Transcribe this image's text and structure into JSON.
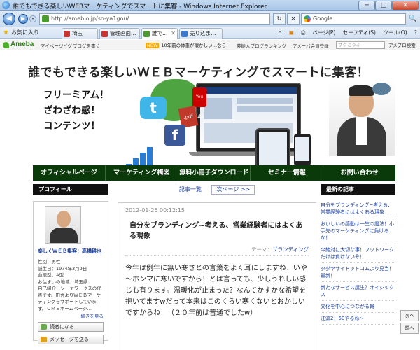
{
  "window": {
    "title": "誰でもできる楽しいWEBマーケティングでスマートに集客 - Windows Internet Explorer",
    "minimize": "─",
    "maximize": "□",
    "close": "✕"
  },
  "address": {
    "url": "http://ameblo.jp/so-ya1gou/",
    "refresh": "↻",
    "stop": "✕",
    "search_engine": "Google",
    "search_go": "🔍"
  },
  "toolbar": {
    "favorites": "お気に入り",
    "tabs": [
      {
        "label": "埼玉",
        "color": "#c33"
      },
      {
        "label": "管理画面…",
        "color": "#c33"
      },
      {
        "label": "誰で…",
        "color": "#4a9c2e"
      },
      {
        "label": "売り込ま…",
        "color": "#3a7ad0"
      }
    ],
    "commands": [
      "ページ(P)",
      "セーフティ(S)",
      "ツール(O)",
      "?"
    ]
  },
  "ameba_bar": {
    "logo": "Ameba",
    "links": [
      "マイページ",
      "ピグ",
      "ブログを書く"
    ],
    "news_badge": "NEW",
    "news": "10年前の体重が懐かしい…なら",
    "links2": [
      "芸能人ブログランキング",
      "アメーバ会員登録"
    ],
    "search_placeholder": "ザクとうふ",
    "search_button": "アメブロ検索"
  },
  "header": {
    "title": "誰でもできる楽しいＷＥＢマーケティングでスマートに集客！",
    "slogan": [
      "フリーミアム！",
      "ざわざわ感！",
      "コンテンツ！"
    ],
    "icons": {
      "twitter": "t",
      "facebook": "f",
      "youtube": "You Tube",
      "pdf": ".pdf",
      "speech": "…"
    }
  },
  "nav": [
    "オフィシャルページ",
    "マーケティング構図",
    "無料小冊子ダウンロード",
    "セミナー情報",
    "お問い合わせ"
  ],
  "profile": {
    "heading": "プロフィール",
    "name": "楽しくＷＥＢ集客：高橋耕也",
    "lines": [
      "性別：男性",
      "誕生日：1974年3月9日",
      "血液型：A型",
      "お住まいの地域：埼玉県",
      "自己紹介：ソーヤワークスの代表です。田舎よりＷＥＢマーケティングをサポートしています。ＣＭＳホームページ…"
    ],
    "more": "続きを見る",
    "reader_button": "読者になる",
    "message_button": "メッセージを送る"
  },
  "article": {
    "list_link": "記事一覧",
    "next_link": "次ページ >>",
    "date": "2012-01-26 00:12:15",
    "title": "自分をブランディング~考える、営業経験者にはよくある現象",
    "theme_label": "テーマ：",
    "theme": "ブランディング",
    "body": "今年は例年に無い寒さとの言葉をよく耳にしますね、いや～ホンマに寒いですから！とは言っても、少しうれしい感じも有ります。温暖化が止まった？なんてかすかな希望を抱いてますwだって本来はこのくらい寒くないとおかしいですからね！（２０年前は普通でしたw）"
  },
  "recent": {
    "heading": "最新の記事",
    "items": [
      "自分をブランディング~考える、営業経験者にはよくある現象",
      "おいしいの感動は一生の魔法！小手先のマーケティングに負けるな！",
      "今絶対に大切な事！フットワークだけは負けないぞ！",
      "タダヤサイドットコムより見当！最新！",
      "新たなサービス誕生？オイシックス",
      "文化を中心につながる輪",
      "江頭2：50やるね～"
    ]
  },
  "scroll": {
    "prev": "次へ",
    "next": "前へ"
  }
}
